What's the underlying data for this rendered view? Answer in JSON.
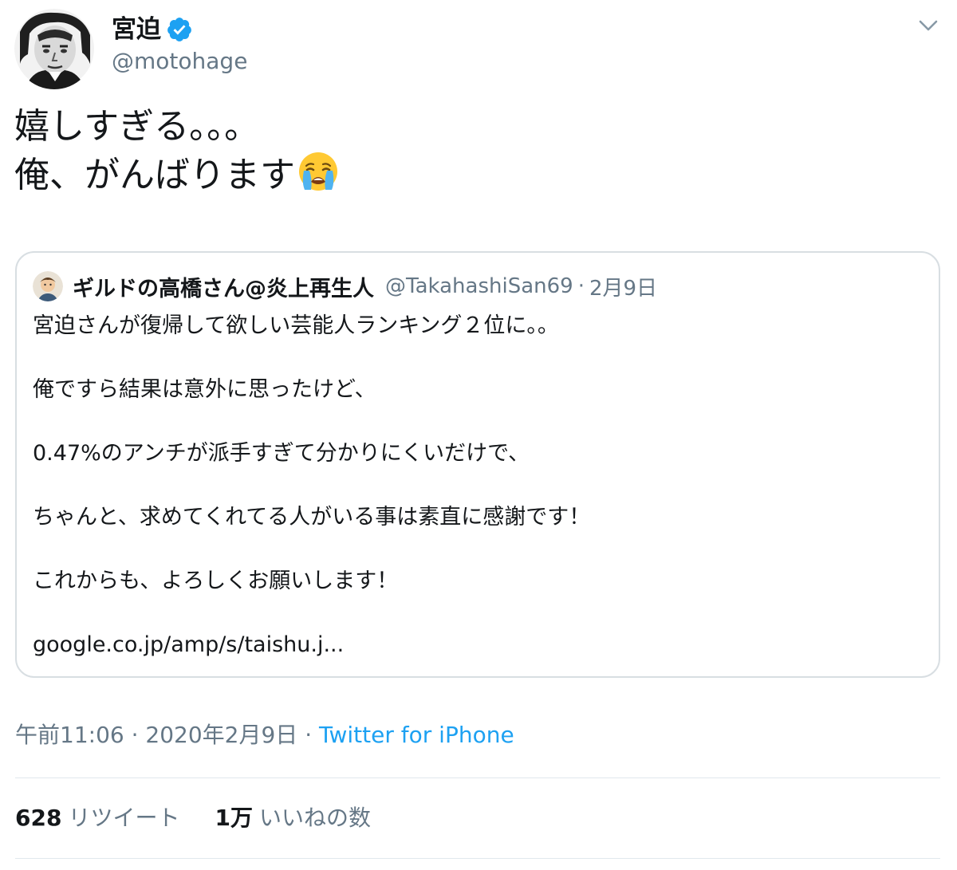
{
  "author": {
    "name": "宮迫",
    "handle": "@motohage",
    "verified": true
  },
  "tweet": {
    "lines": [
      "嬉しすぎる。。。",
      "俺、がんばります"
    ],
    "emoji": "loudly-crying-face-emoji"
  },
  "quote": {
    "author_name": "ギルドの高橋さん@炎上再生人",
    "author_handle": "@TakahashiSan69",
    "separator": "·",
    "date": "2月9日",
    "lines": [
      "宮迫さんが復帰して欲しい芸能人ランキング２位に。。",
      "俺ですら結果は意外に思ったけど、",
      "0.47%のアンチが派手すぎて分かりにくいだけで、",
      "ちゃんと、求めてくれてる人がいる事は素直に感謝です！",
      "これからも、よろしくお願いします！",
      "google.co.jp/amp/s/taishu.j..."
    ]
  },
  "meta": {
    "time": "午前11:06",
    "separator": "·",
    "date": "2020年2月9日",
    "source": "Twitter for iPhone"
  },
  "stats": {
    "retweets_count": "628",
    "retweets_label": "リツイート",
    "likes_count": "1万",
    "likes_label": "いいねの数"
  },
  "colors": {
    "text": "#14171a",
    "muted": "#657786",
    "accent": "#1da1f2",
    "border": "#d8dee2",
    "verified": "#1da1f2"
  }
}
